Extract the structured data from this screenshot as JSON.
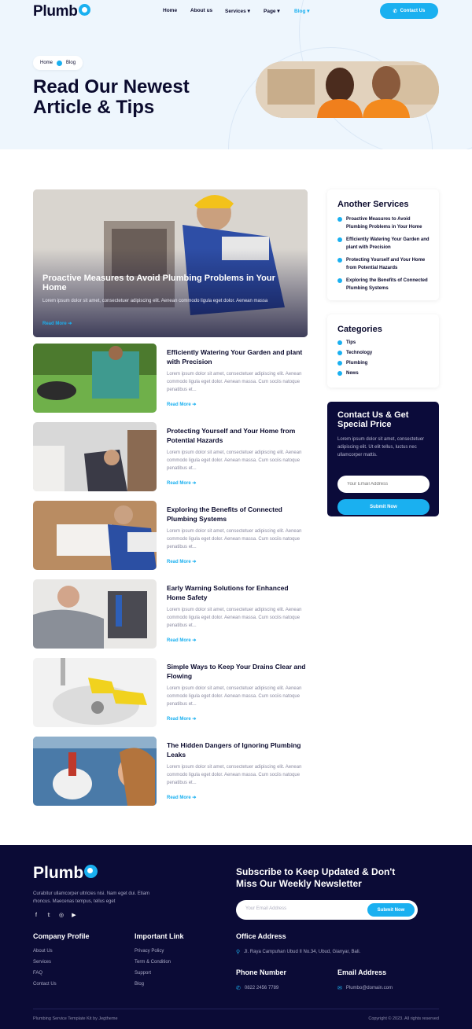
{
  "brand": {
    "name": "Plumb",
    "accent": "#1ab0f0",
    "dark": "#0b0b36"
  },
  "nav": {
    "items": [
      "Home",
      "About us",
      "Services",
      "Page",
      "Blog"
    ],
    "active": "Blog",
    "contact_label": "Contact Us"
  },
  "hero": {
    "breadcrumb": [
      "Home",
      "Blog"
    ],
    "title": "Read Our Newest Article & Tips"
  },
  "featured": {
    "title": "Proactive Measures to Avoid Plumbing Problems in Your Home",
    "text": "Lorem ipsum dolor sit amet, consectetuer adipiscing elit. Aenean commodo ligula eget dolor. Aenean massa",
    "read_more": "Read More"
  },
  "articles": [
    {
      "title": "Efficiently Watering Your Garden and plant with Precision",
      "text": "Lorem ipsum dolor sit amet, consectetuer adipiscing elit. Aenean commodo ligula eget dolor. Aenean massa. Cum sociis natoque penatibus et...",
      "read_more": "Read More"
    },
    {
      "title": "Protecting Yourself and Your Home from Potential Hazards",
      "text": "Lorem ipsum dolor sit amet, consectetuer adipiscing elit. Aenean commodo ligula eget dolor. Aenean massa. Cum sociis natoque penatibus et...",
      "read_more": "Read More"
    },
    {
      "title": "Exploring the Benefits of Connected Plumbing Systems",
      "text": "Lorem ipsum dolor sit amet, consectetuer adipiscing elit. Aenean commodo ligula eget dolor. Aenean massa. Cum sociis natoque penatibus et...",
      "read_more": "Read More"
    },
    {
      "title": "Early Warning Solutions for Enhanced Home Safety",
      "text": "Lorem ipsum dolor sit amet, consectetuer adipiscing elit. Aenean commodo ligula eget dolor. Aenean massa. Cum sociis natoque penatibus et...",
      "read_more": "Read More"
    },
    {
      "title": "Simple Ways to Keep Your Drains Clear and Flowing",
      "text": "Lorem ipsum dolor sit amet, consectetuer adipiscing elit. Aenean commodo ligula eget dolor. Aenean massa. Cum sociis natoque penatibus et...",
      "read_more": "Read More"
    },
    {
      "title": "The Hidden Dangers of Ignoring Plumbing Leaks",
      "text": "Lorem ipsum dolor sit amet, consectetuer adipiscing elit. Aenean commodo ligula eget dolor. Aenean massa. Cum sociis natoque penatibus et...",
      "read_more": "Read More"
    }
  ],
  "sidebar": {
    "services_title": "Another Services",
    "services": [
      "Proactive Measures to Avoid Plumbing Problems in Your Home",
      "Efficiently Watering Your Garden and plant with Precision",
      "Protecting Yourself and Your Home from Potential Hazards",
      "Exploring the Benefits of Connected Plumbing Systems"
    ],
    "categories_title": "Categories",
    "categories": [
      "Tips",
      "Technology",
      "Plumbing",
      "News"
    ],
    "contact": {
      "title": "Contact Us & Get Special Price",
      "text": "Lorem ipsum dolor sit amet, consectetuer adipiscing elit. Ut elit tellus, luctus nec ullamcorper mattis.",
      "email_placeholder": "Your Email Address",
      "submit_label": "Submit Now"
    }
  },
  "footer": {
    "description": "Curabitur ullamcorper ultricies nisi. Nam eget dui. Etiam rhoncus. Maecenas tempus, tellus eget",
    "newsletter_title": "Subscribe to Keep Updated & Don't Miss Our Weekly Newsletter",
    "newsletter_placeholder": "Your Email Address",
    "newsletter_button": "Submit Now",
    "company_title": "Company Profile",
    "company_links": [
      "About Us",
      "Services",
      "FAQ",
      "Contact Us"
    ],
    "important_title": "Important Link",
    "important_links": [
      "Privacy Policy",
      "Term & Condition",
      "Support",
      "Blog"
    ],
    "office_title": "Office Address",
    "office_address": "Jl. Raya Campuhan Ubud II No.34, Ubud, Gianyar, Bali.",
    "phone_title": "Phone Number",
    "phone": "0822 2456 7789",
    "email_title": "Email Address",
    "email": "Plumbo@domain.com",
    "credit": "Plumbing Service Template Kit by Jegtheme",
    "copyright": "Copyright © 2023. All rights reserved"
  }
}
